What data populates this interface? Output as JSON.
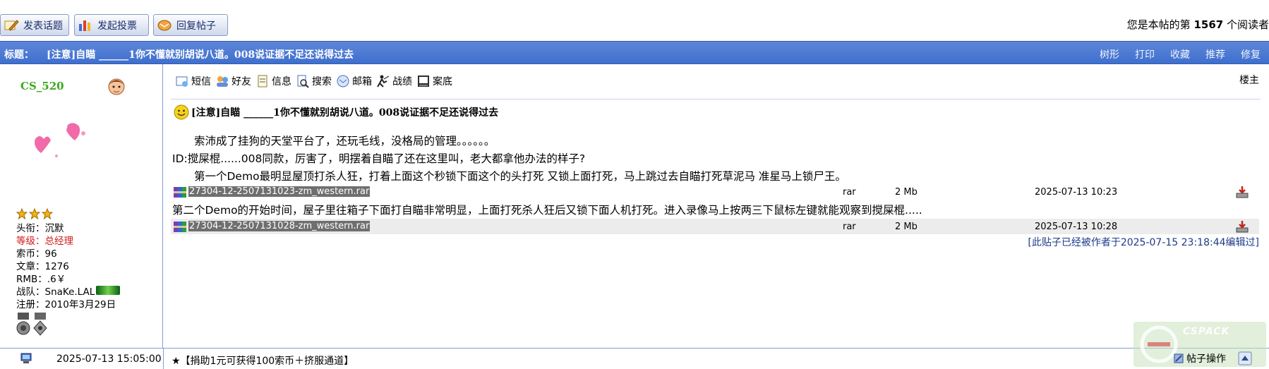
{
  "toolbar": {
    "new_topic": "发表话题",
    "new_poll": "发起投票",
    "reply": "回复帖子"
  },
  "reader": {
    "prefix": "您是本帖的第",
    "count": "1567",
    "suffix": "个阅读者"
  },
  "titlebar": {
    "label": "标题：",
    "title": "[注意]自瞄 ______1你不懂就别胡说八道。008说证据不足还说得过去",
    "actions": [
      "树形",
      "打印",
      "收藏",
      "推荐",
      "修复"
    ]
  },
  "user": {
    "name": "CS_520",
    "title_label": "头衔：",
    "title_value": "沉默",
    "level_label": "等级：",
    "level_value": "总经理",
    "coins_label": "索币：",
    "coins_value": "96",
    "posts_label": "文章：",
    "posts_value": "1276",
    "rmb_label": "RMB：",
    "rmb_value": ".6￥",
    "team_label": "战队：",
    "team_value": "SnaKe.LAL",
    "reg_label": "注册：",
    "reg_value": "2010年3月29日"
  },
  "userbar": {
    "items": [
      "短信",
      "好友",
      "信息",
      "搜索",
      "邮箱",
      "战绩",
      "案底"
    ],
    "floor": "楼主"
  },
  "post": {
    "title": "[注意]自瞄 ______1你不懂就别胡说八道。008说证据不足还说得过去",
    "line1": "　　索沛成了挂狗的天堂平台了，还玩毛线，没格局的管理。。。。。。",
    "line2": "ID:搅屎棍......008同款，厉害了，明摆着自瞄了还在这里叫，老大都拿他办法的样子?",
    "line3": "　　第一个Demo最明显屋顶打杀人狂，打着上面这个秒锁下面这个的头打死 又锁上面打死，马上跳过去自瞄打死草泥马 准星马上锁尸王。",
    "line4": "第二个Demo的开始时间，屋子里往箱子下面打自瞄非常明显，上面打死杀人狂后又锁下面人机打死。进入录像马上按两三下鼠标左键就能观察到搅屎棍.....",
    "edit_note": "[此贴子已经被作者于2025-07-15 23:18:44编辑过]"
  },
  "attachments": [
    {
      "name": "27304-12-2507131023-zm_western.rar",
      "type": "rar",
      "size": "2 Mb",
      "date": "2025-07-13 10:23"
    },
    {
      "name": "27304-12-2507131028-zm_western.rar",
      "type": "rar",
      "size": "2 Mb",
      "date": "2025-07-13 10:28"
    }
  ],
  "footer": {
    "post_time": "2025-07-13 15:05:00",
    "promo": "★【捐助1元可获得100索币＋挤服通道】",
    "post_ops": "帖子操作"
  },
  "colors": {
    "title_bar": "#4a79d3",
    "username": "#3aa81e",
    "level": "#d01b1b",
    "edit_note": "#1d3b8a"
  },
  "icons": [
    "pencil-icon",
    "bar-chart-icon",
    "reply-icon",
    "avatar-face-icon",
    "star-icon",
    "message-icon",
    "friends-icon",
    "info-icon",
    "search-icon",
    "mail-icon",
    "record-icon",
    "file-icon",
    "smile-icon",
    "archive-icon",
    "download-icon",
    "computer-icon",
    "tool-icon",
    "scroll-up-icon",
    "medal-icon"
  ]
}
